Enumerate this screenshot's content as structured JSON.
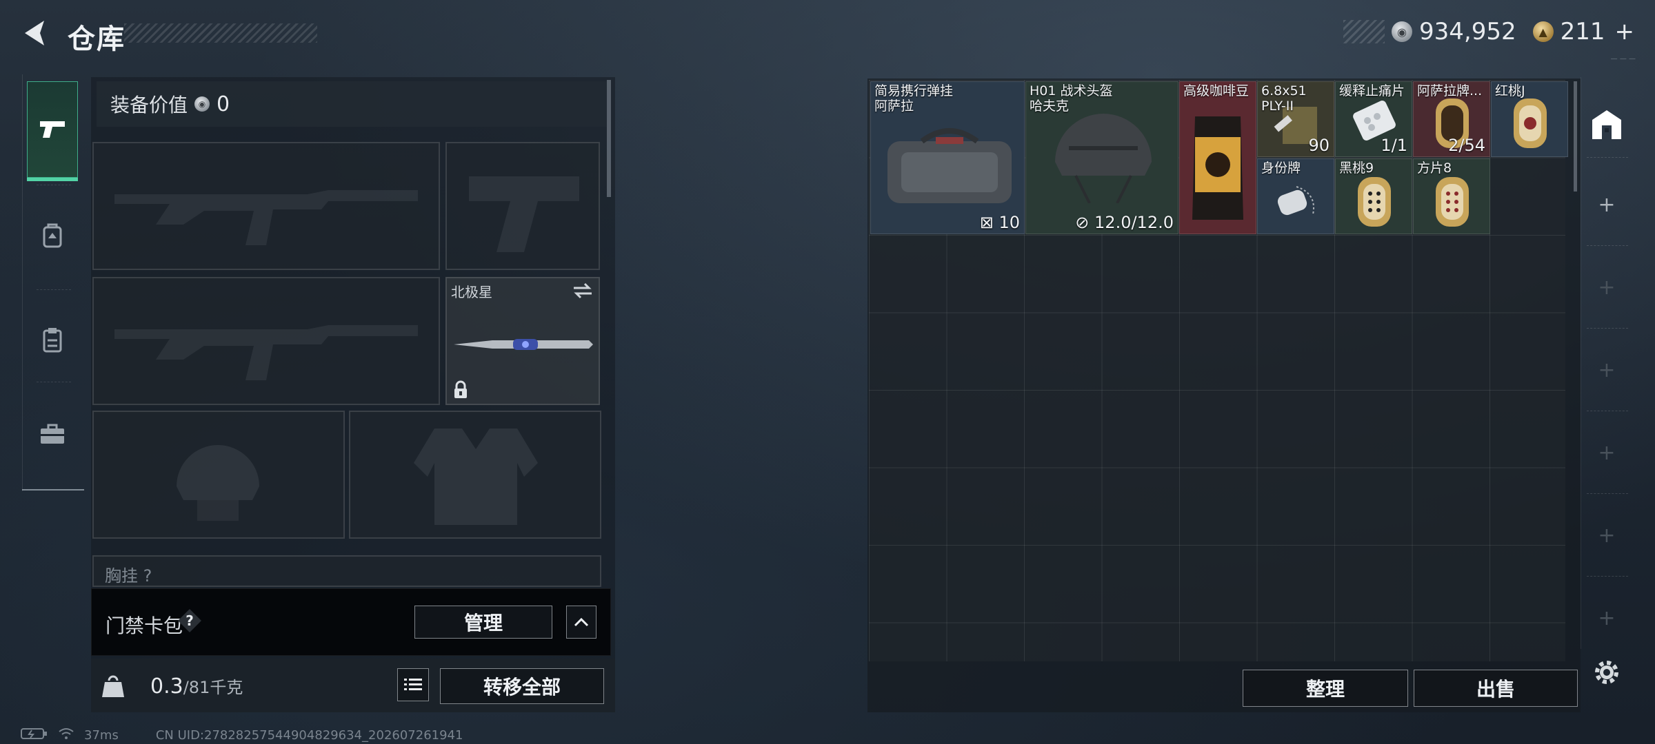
{
  "header": {
    "title": "仓库",
    "currency": [
      {
        "icon": "silver-coin-icon",
        "value": "934,952"
      },
      {
        "icon": "gold-coin-icon",
        "value": "211"
      }
    ],
    "plus_label": "+"
  },
  "sidebar": {
    "tabs": [
      {
        "icon": "pistol-icon",
        "active": true
      },
      {
        "icon": "backpack-icon",
        "active": false
      },
      {
        "icon": "clipboard-icon",
        "active": false
      },
      {
        "icon": "toolbox-icon",
        "active": false
      }
    ]
  },
  "loadout": {
    "equip_value_label": "装备价值",
    "equip_value": "0",
    "melee_slot_label": "北极星",
    "chest_rig_label": "胸挂 ?",
    "keycard_label": "门禁卡包",
    "help_label": "?",
    "manage_label": "管理",
    "weight_current": "0.3",
    "weight_max": "/81千克",
    "weight_badge": "KG",
    "transfer_all_label": "转移全部"
  },
  "stash": {
    "items": [
      {
        "name": "简易携行弹挂\n阿萨拉",
        "count": "10",
        "bg": "#2b3a4a"
      },
      {
        "name": "H01 战术头盔\n哈夫克",
        "count": "12.0/12.0",
        "bg": "#2a3a35"
      },
      {
        "name": "高级咖啡豆",
        "count": "",
        "bg": "#5a2930"
      },
      {
        "name": "6.8x51\nPLY-II",
        "count": "90",
        "bg": "#3a3a2e"
      },
      {
        "name": "缓释止痛片",
        "count": "1/1",
        "bg": "#2a3a35"
      },
      {
        "name": "阿萨拉牌...",
        "count": "2/54",
        "bg": "#4a2a30"
      },
      {
        "name": "红桃J",
        "count": "",
        "bg": "#2b3a4a"
      },
      {
        "name": "身份牌",
        "count": "",
        "bg": "#2b3a4a"
      },
      {
        "name": "黑桃9",
        "count": "",
        "bg": "#2a3a35"
      },
      {
        "name": "方片8",
        "count": "",
        "bg": "#2a3a35"
      }
    ],
    "sort_label": "整理",
    "sell_label": "出售"
  },
  "status": {
    "ping": "37ms",
    "uid": "CN UID:27828257544904829634_202607261941"
  }
}
